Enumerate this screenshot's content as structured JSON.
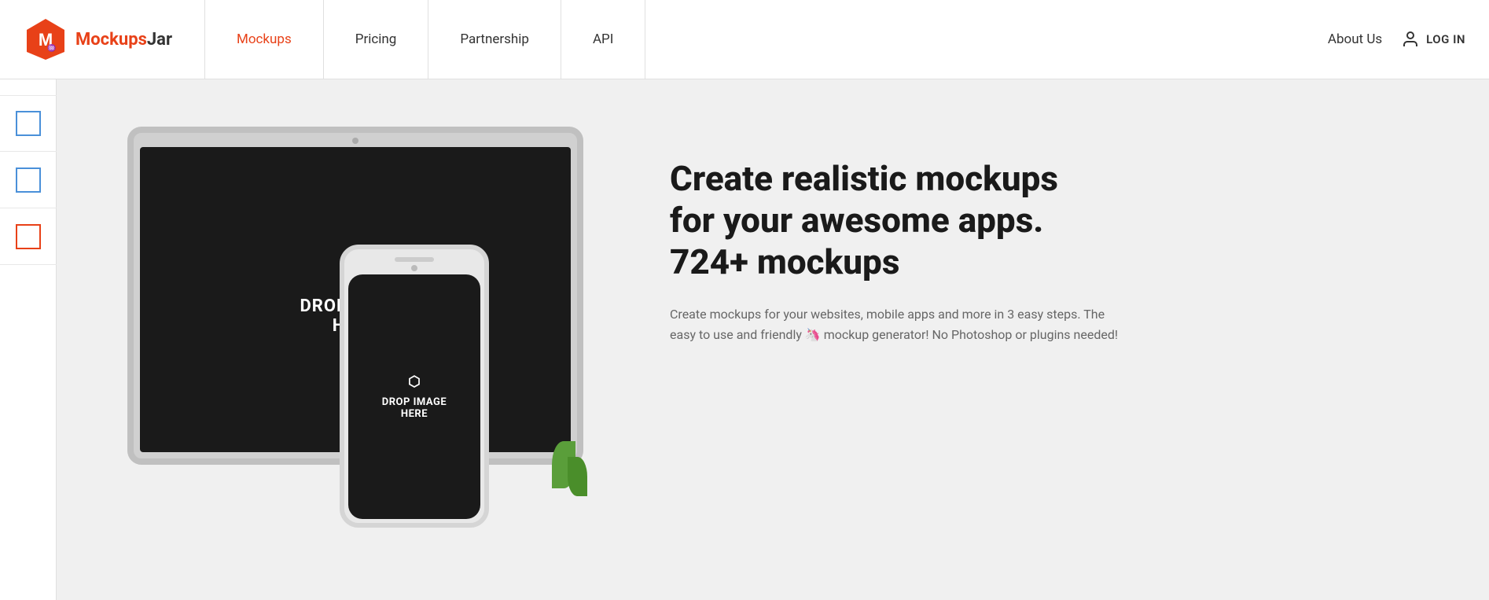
{
  "navbar": {
    "logo_text_brand": "Mockups",
    "logo_text_suffix": "Jar",
    "nav_items": [
      {
        "label": "Mockups",
        "active": true
      },
      {
        "label": "Pricing",
        "active": false
      },
      {
        "label": "Partnership",
        "active": false
      },
      {
        "label": "API",
        "active": false
      }
    ],
    "about_label": "About Us",
    "login_label": "LOG IN"
  },
  "sidebar": {
    "items": [
      {
        "type": "blue-box"
      },
      {
        "type": "blue-box"
      },
      {
        "type": "red-box"
      }
    ]
  },
  "hero": {
    "mockup": {
      "tablet_drop_text_line1": "DROP IMAGE",
      "tablet_drop_text_line2": "HERE",
      "phone_drop_text_line1": "DROP IMAGE",
      "phone_drop_text_line2": "HERE"
    },
    "title_line1": "Create realistic mockups",
    "title_line2": "for your awesome apps.",
    "title_line3": "724+ mockups",
    "description": "Create mockups for your websites, mobile apps and more in 3 easy steps. The easy to use and friendly 🦄 mockup generator! No Photoshop or plugins needed!"
  }
}
